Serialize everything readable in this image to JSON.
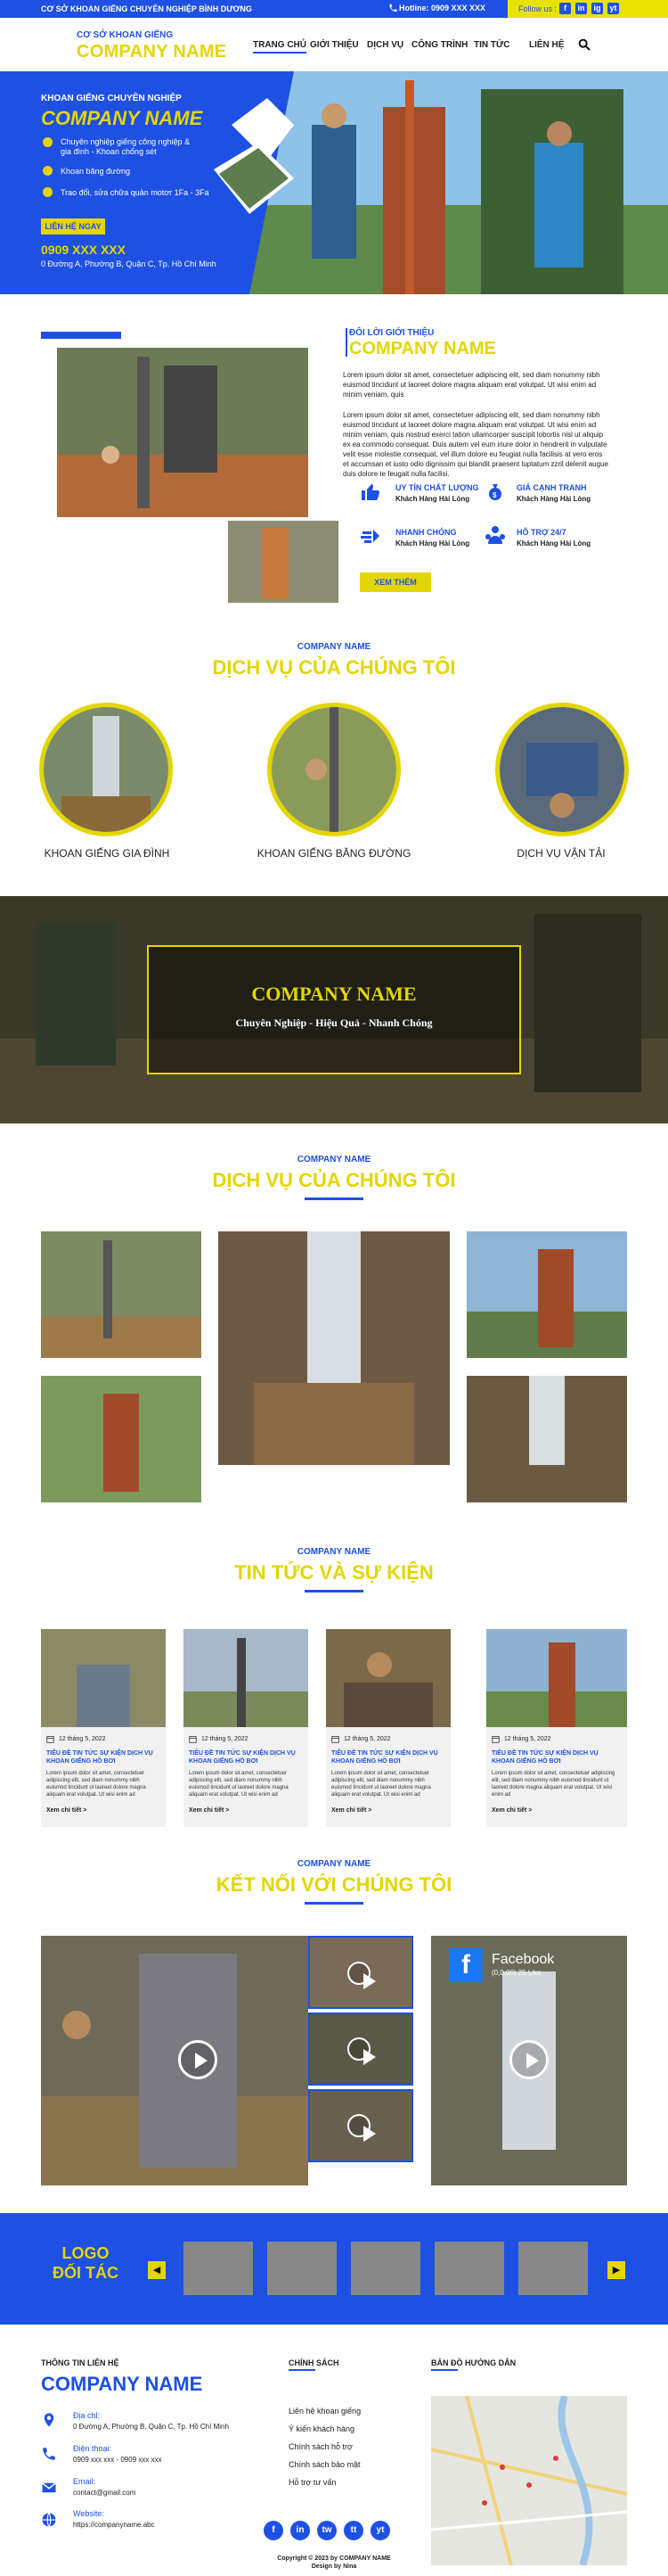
{
  "topbar": {
    "slogan": "CƠ SỞ KHOAN GIẾNG CHUYÊN NGHIỆP BÌNH DƯƠNG",
    "hotline": "Hotline: 0909 XXX XXX",
    "follow": "Follow us :",
    "socials": [
      "f",
      "in",
      "ig",
      "yt"
    ]
  },
  "header": {
    "small": "CƠ SỞ KHOAN GIẾNG",
    "name": "COMPANY NAME",
    "nav": [
      "TRANG CHỦ",
      "GIỚI THIỆU",
      "DỊCH VỤ",
      "CÔNG TRÌNH",
      "TIN TỨC",
      "LIÊN HỆ"
    ],
    "active": "TRANG CHỦ"
  },
  "hero": {
    "line1": "KHOAN GIẾNG CHUYÊN NGHIỆP",
    "name": "COMPANY NAME",
    "items": [
      "Chuyên nghiệp giếng công nghiệp & gia đình - Khoan chống sét",
      "Khoan băng đường",
      "Trao đổi, sửa chữa quản motơr 1Fa - 3Fa"
    ],
    "button": "LIÊN HỆ NGAY",
    "phone": "0909 XXX XXX",
    "address": "0 Đường A, Phường B, Quận C, Tp. Hồ Chí Minh"
  },
  "about": {
    "small": "ĐÔI LỜI GIỚI THIỆU",
    "title": "COMPANY NAME",
    "p1": "Lorem ipsum dolor sit amet, consectetuer adipiscing elit, sed diam nonummy nibh euismod tincidunt ut laoreet dolore magna aliquam erat volutpat. Ut wisi enim ad minim veniam, quis",
    "p2": "Lorem ipsum dolor sit amet, consectetuer adipiscing elit, sed diam nonummy nibh euismod tincidunt ut laoreet dolore magna aliquam erat volutpat. Ut wisi enim ad minim veniam, quis nostrud exerci tation ullamcorper suscipit lobortis nisl ut aliquip ex ea commodo consequat. Duis autem vel eum iriure dolor in hendrerit in vulputate velit esse molestie consequat, vel illum dolore eu feugiat nulla facilisis at vero eros et accumsan et iusto odio dignissim qui blandit praesent luptatum zzril delenit augue duis dolore te feugait nulla facilisi.",
    "features": [
      {
        "title": "UY TÍN CHẤT LƯỢNG",
        "sub": "Khách Hàng Hài Lòng"
      },
      {
        "title": "GIÁ CẠNH TRANH",
        "sub": "Khách Hàng Hài Lòng"
      },
      {
        "title": "NHANH CHÓNG",
        "sub": "Khách Hàng Hài Lòng"
      },
      {
        "title": "HỖ TRỢ 24/7",
        "sub": "Khách Hàng Hài Lòng"
      }
    ],
    "button": "XEM THÊM"
  },
  "services": {
    "small": "COMPANY NAME",
    "title": "DỊCH VỤ CỦA CHÚNG TÔI",
    "items": [
      "KHOAN GIẾNG GIA ĐÌNH",
      "KHOAN GIẾNG BĂNG ĐƯỜNG",
      "DỊCH VỤ VẬN TẢI"
    ]
  },
  "banner": {
    "title": "COMPANY NAME",
    "sub": "Chuyên Nghiệp - Hiệu Quả - Nhanh Chóng"
  },
  "gallery": {
    "small": "COMPANY NAME",
    "title": "DỊCH VỤ CỦA CHÚNG TÔI"
  },
  "news": {
    "small": "COMPANY NAME",
    "title": "TIN TỨC VÀ SỰ KIỆN",
    "cards": [
      {
        "date": "12 tháng 5, 2022",
        "title": "TIÊU ĐỀ TIN TỨC SỰ KIỆN DỊCH VỤ KHOAN GIẾNG HỒ BƠI",
        "desc": "Lorem ipsum dolor sit amet, consectetuer adipiscing elit, sed diam nonummy nibh euismod tincidunt ut laoreet dolore magna aliquam erat volutpat. Ut wisi enim ad",
        "more": "Xem chi tiết >"
      },
      {
        "date": "12 tháng 5, 2022",
        "title": "TIÊU ĐỀ TIN TỨC SỰ KIỆN DỊCH VỤ KHOAN GIẾNG HỒ BƠI",
        "desc": "Lorem ipsum dolor sit amet, consectetuer adipiscing elit, sed diam nonummy nibh euismod tincidunt ut laoreet dolore magna aliquam erat volutpat. Ut wisi enim ad",
        "more": "Xem chi tiết >"
      },
      {
        "date": "12 tháng 5, 2022",
        "title": "TIÊU ĐỀ TIN TỨC SỰ KIỆN DỊCH VỤ KHOAN GIẾNG HỒ BƠI",
        "desc": "Lorem ipsum dolor sit amet, consectetuer adipiscing elit, sed diam nonummy nibh euismod tincidunt ut laoreet dolore magna aliquam erat volutpat. Ut wisi enim ad",
        "more": "Xem chi tiết >"
      },
      {
        "date": "12 tháng 5, 2022",
        "title": "TIÊU ĐỀ TIN TỨC SỰ KIỆN DỊCH VỤ KHOAN GIẾNG HỒ BƠI",
        "desc": "Lorem ipsum dolor sit amet, consectetuer adipiscing elit, sed diam nonummy nibh euismod tincidunt ut laoreet dolore magna aliquam erat volutpat. Ut wisi enim ad",
        "more": "Xem chi tiết >"
      }
    ]
  },
  "connect": {
    "small": "COMPANY NAME",
    "title": "KẾT NỐI VỚI CHÚNG TÔI",
    "facebook": "Facebook",
    "fb_sub": "(0,0.00) 25 Like"
  },
  "partners": {
    "label1": "LOGO",
    "label2": "ĐỐI TÁC"
  },
  "footer": {
    "contact_h": "THÔNG TIN LIÊN HỆ",
    "name": "COMPANY NAME",
    "address_l": "Địa chỉ:",
    "address_v": "0 Đường A, Phường B, Quận C, Tp. Hồ Chí Minh",
    "phone_l": "Điện thoại:",
    "phone_v": "0909 xxx xxx - 0909 xxx xxx",
    "email_l": "Email:",
    "email_v": "contact@gmail.com",
    "web_l": "Website:",
    "web_v": "https://companyname.abc",
    "policy_h": "CHÍNH SÁCH",
    "policies": [
      "Liên hệ khoan giếng",
      "Ý kiến khách hàng",
      "Chính sách hỗ trợ",
      "Chính sách bảo mật",
      "Hỗ trợ tư vấn"
    ],
    "map_h": "BẢN ĐỒ HƯỚNG DẪN",
    "socials": [
      "f",
      "in",
      "tw",
      "tt",
      "yt"
    ],
    "copy1": "Copyright © 2023 by COMPANY NAME",
    "copy2": "Design by Nina"
  }
}
